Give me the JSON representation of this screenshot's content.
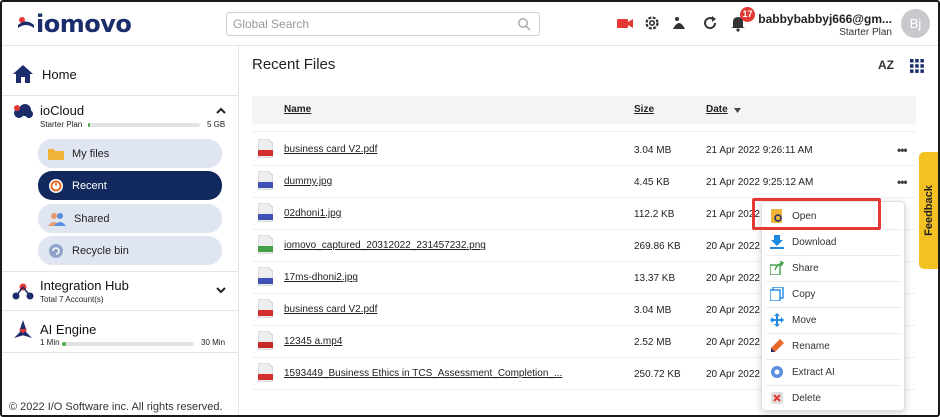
{
  "header": {
    "logo_text": "iomovo",
    "search_placeholder": "Global Search",
    "notification_count": "17",
    "user_email": "babbybabbyj666@gm...",
    "user_plan": "Starter Plan",
    "avatar_initials": "Bj"
  },
  "sidebar": {
    "home_label": "Home",
    "iocloud": {
      "title": "ioCloud",
      "plan": "Starter Plan",
      "storage_total": "5 GB",
      "usage_fraction": 0.01
    },
    "items": [
      {
        "label": "My files",
        "icon": "folder-icon",
        "active": false
      },
      {
        "label": "Recent",
        "icon": "recent-icon",
        "active": true
      },
      {
        "label": "Shared",
        "icon": "shared-icon",
        "active": false
      },
      {
        "label": "Recycle bin",
        "icon": "recycle-bin-icon",
        "active": false
      }
    ],
    "integration_hub": {
      "title": "Integration Hub",
      "subtitle": "Total 7 Account(s)"
    },
    "ai_engine": {
      "title": "AI Engine",
      "min_label": "1 Min",
      "max_label": "30 Min",
      "usage_fraction": 0.03
    },
    "copyright": "© 2022 I/O Software inc. All rights reserved."
  },
  "main": {
    "title": "Recent Files",
    "sort_label": "AZ",
    "columns": {
      "name": "Name",
      "size": "Size",
      "date": "Date"
    },
    "rows": [
      {
        "type": "PDF",
        "name": "business card V2.pdf",
        "size": "3.04 MB",
        "date": "21 Apr 2022 9:26:11 AM"
      },
      {
        "type": "IMG",
        "name": "dummy.jpg",
        "size": "4.45 KB",
        "date": "21 Apr 2022 9:25:12 AM"
      },
      {
        "type": "IMG",
        "name": "02dhoni1.jpg",
        "size": "112.2 KB",
        "date": "21 Apr 2022"
      },
      {
        "type": "PNG",
        "name": "iomovo_captured_20312022_231457232.png",
        "size": "269.86 KB",
        "date": "20 Apr 2022"
      },
      {
        "type": "IMG",
        "name": "17ms-dhoni2.jpg",
        "size": "13.37 KB",
        "date": "20 Apr 2022"
      },
      {
        "type": "PDF",
        "name": "business card V2.pdf",
        "size": "3.04 MB",
        "date": "20 Apr 2022"
      },
      {
        "type": "MP4",
        "name": "12345 a.mp4",
        "size": "2.52 MB",
        "date": "20 Apr 2022"
      },
      {
        "type": "PDF",
        "name": "1593449_Business Ethics in TCS_Assessment_Completion_...",
        "size": "250.72 KB",
        "date": "20 Apr 2022"
      }
    ]
  },
  "context_menu": {
    "items": [
      {
        "label": "Open",
        "icon": "open-icon"
      },
      {
        "label": "Download",
        "icon": "download-icon"
      },
      {
        "label": "Share",
        "icon": "share-icon"
      },
      {
        "label": "Copy",
        "icon": "copy-icon"
      },
      {
        "label": "Move",
        "icon": "move-icon"
      },
      {
        "label": "Rename",
        "icon": "rename-icon"
      },
      {
        "label": "Extract AI",
        "icon": "extract-ai-icon"
      },
      {
        "label": "Delete",
        "icon": "delete-icon"
      }
    ]
  },
  "feedback_label": "Feedback",
  "colors": {
    "accent_navy": "#12295e",
    "highlight_red": "#e53935",
    "feedback_yellow": "#f4c122"
  }
}
